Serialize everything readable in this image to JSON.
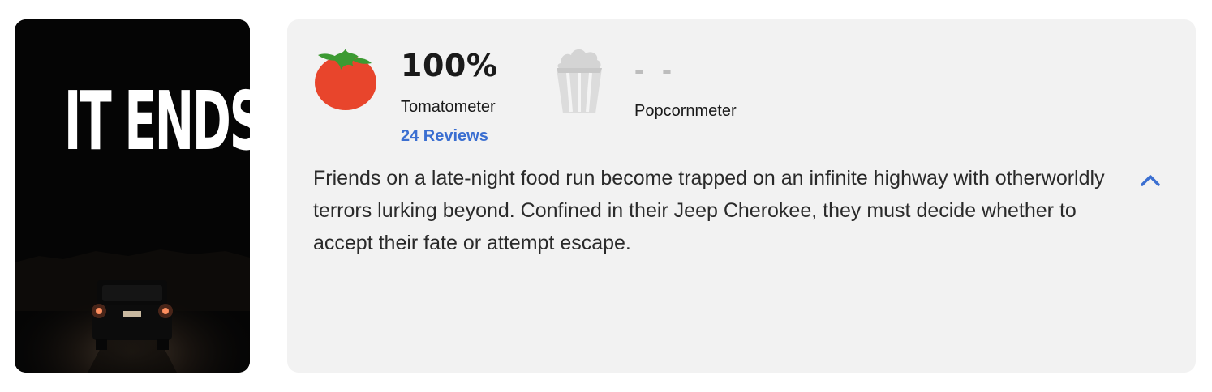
{
  "poster": {
    "title_text": "IT ENDS"
  },
  "tomatometer": {
    "score": "100%",
    "label": "Tomatometer",
    "reviews_link": "24 Reviews",
    "icon": "tomato-icon",
    "link_color": "#3b6fd1"
  },
  "popcornmeter": {
    "score": "- -",
    "label": "Popcornmeter",
    "icon": "popcorn-bucket-icon"
  },
  "synopsis": {
    "text": "Friends on a late-night food run become trapped on an infinite highway with otherworldly terrors lurking beyond. Confined in their Jeep Cherokee, they must decide whether to accept their fate or attempt escape."
  },
  "collapse": {
    "icon": "chevron-up-icon"
  },
  "colors": {
    "card_background": "#f2f2f2",
    "tomato_red": "#e8452c",
    "tomato_leaf": "#3c9a32",
    "accent_blue": "#3b6fd1"
  }
}
